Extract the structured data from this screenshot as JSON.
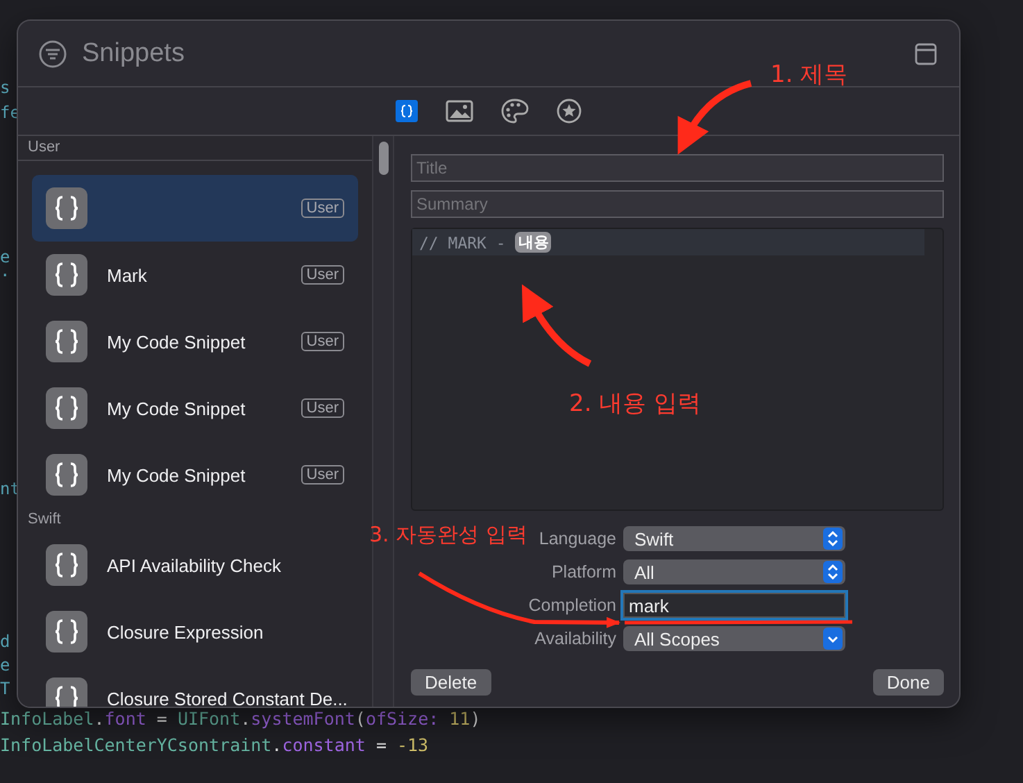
{
  "editor": {
    "fragments": [
      "s",
      "fe",
      "e",
      ".",
      "nt",
      "d",
      "e",
      "T"
    ],
    "lines": [
      [
        {
          "kind": "type",
          "text": "InfoLabel"
        },
        {
          "kind": "plain",
          "text": "."
        },
        {
          "kind": "member",
          "text": "font"
        },
        {
          "kind": "plain",
          "text": " = "
        },
        {
          "kind": "type",
          "text": "UIFont"
        },
        {
          "kind": "plain",
          "text": "."
        },
        {
          "kind": "member",
          "text": "systemFont"
        },
        {
          "kind": "plain",
          "text": "("
        },
        {
          "kind": "member",
          "text": "ofSize: "
        },
        {
          "kind": "number",
          "text": "11"
        },
        {
          "kind": "plain",
          "text": ")"
        }
      ],
      [
        {
          "kind": "type",
          "text": "InfoLabelCenterYCsontraint"
        },
        {
          "kind": "plain",
          "text": "."
        },
        {
          "kind": "member",
          "text": "constant"
        },
        {
          "kind": "plain",
          "text": " = "
        },
        {
          "kind": "number",
          "text": "-13"
        }
      ]
    ]
  },
  "window": {
    "title": "Snippets"
  },
  "toolbar_tabs": [
    {
      "kind": "code",
      "selected": true
    },
    {
      "kind": "image",
      "selected": false
    },
    {
      "kind": "palette",
      "selected": false
    },
    {
      "kind": "star",
      "selected": false
    }
  ],
  "sidebar": {
    "sections": [
      {
        "title": "User",
        "items": [
          {
            "selected": true,
            "badge": "User"
          },
          {
            "name": "Mark",
            "selected": false,
            "badge": "User"
          },
          {
            "name": "My Code Snippet",
            "selected": false,
            "badge": "User"
          },
          {
            "name": "My Code Snippet",
            "selected": false,
            "badge": "User"
          },
          {
            "name": "My Code Snippet",
            "selected": false,
            "badge": "User"
          }
        ]
      },
      {
        "title": "Swift",
        "items": [
          {
            "name": "API Availability Check",
            "selected": false
          },
          {
            "name": "Closure Expression",
            "selected": false
          },
          {
            "name": "Closure Stored Constant De...",
            "selected": false
          }
        ]
      }
    ]
  },
  "detail": {
    "title_field": {
      "placeholder": "Title"
    },
    "summary_field": {
      "placeholder": "Summary"
    },
    "code": {
      "text": "// MARK - ",
      "token": "내용"
    },
    "form": [
      {
        "label": "Language",
        "kind": "popup",
        "value": "Swift"
      },
      {
        "label": "Platform",
        "kind": "popup",
        "value": "All"
      },
      {
        "label": "Completion",
        "kind": "text",
        "value": "mark",
        "focused": true
      },
      {
        "label": "Availability",
        "kind": "menu",
        "value": "All Scopes"
      }
    ],
    "buttons": [
      "Delete",
      "Done"
    ]
  },
  "annotations": [
    "1. 제목",
    "2. 내용 입력",
    "3. 자동완성 입력"
  ]
}
